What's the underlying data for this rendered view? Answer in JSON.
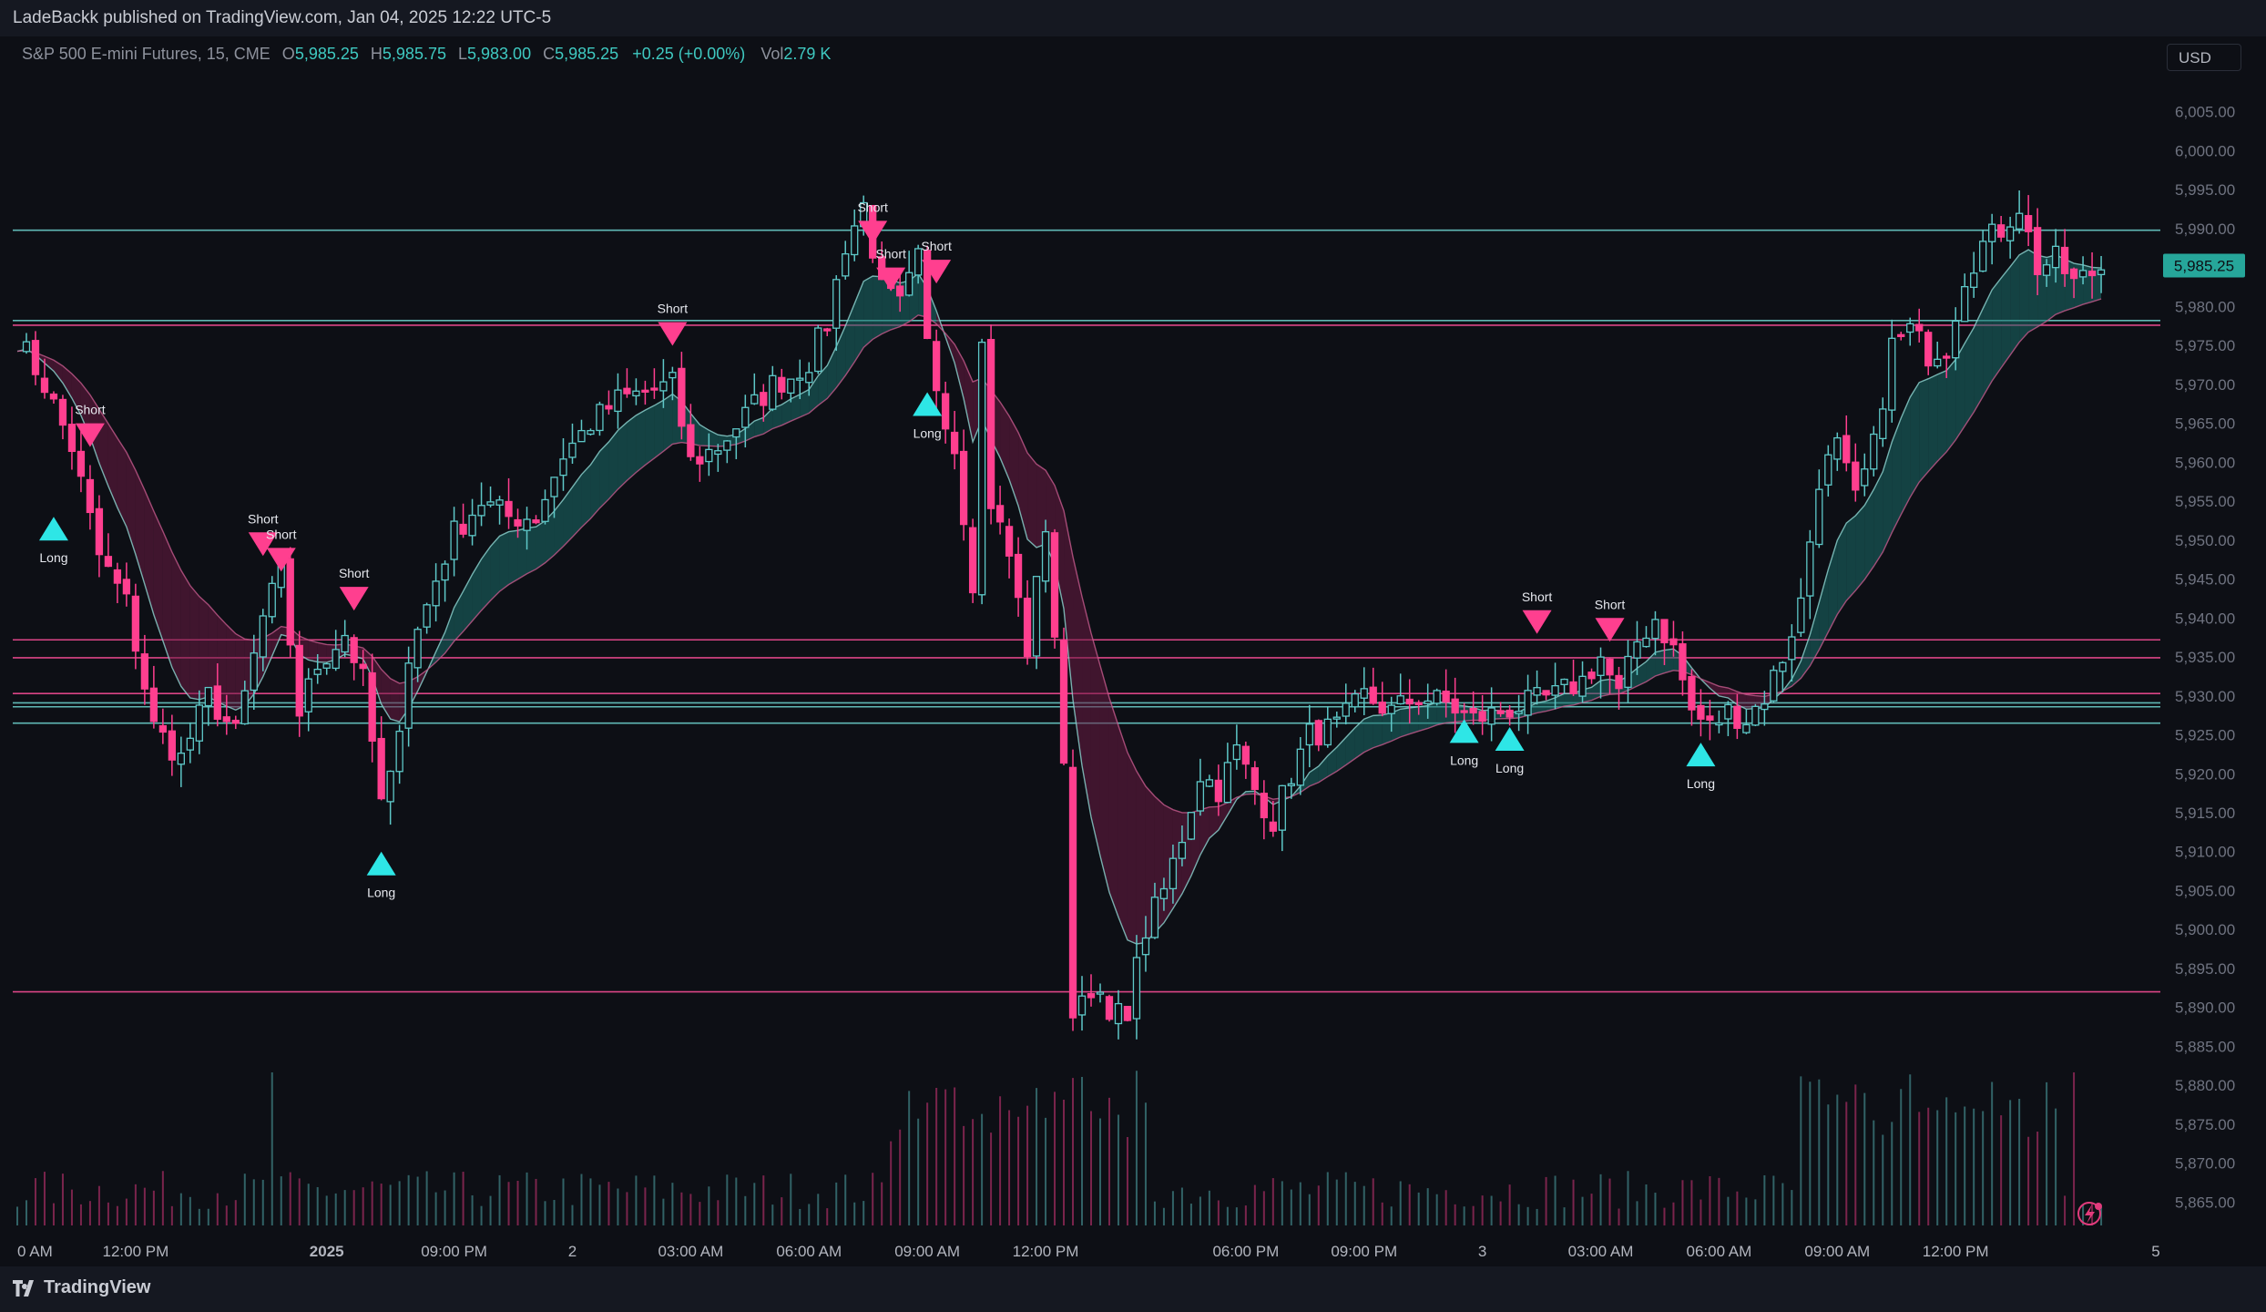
{
  "header": {
    "published": "LadeBackk published on TradingView.com, Jan 04, 2025 12:22 UTC-5"
  },
  "legend": {
    "symbol": "S&P 500 E-mini Futures, 15, CME",
    "o_label": "O",
    "o": "5,985.25",
    "h_label": "H",
    "h": "5,985.75",
    "l_label": "L",
    "l": "5,983.00",
    "c_label": "C",
    "c": "5,985.25",
    "change": "+0.25 (+0.00%)",
    "vol_label": "Vol",
    "vol": "2.79 K"
  },
  "currency": "USD",
  "footer": {
    "brand": "TradingView"
  },
  "colors": {
    "bull": "#5ec8c8",
    "bear": "#ff3f8f",
    "level_teal": "#6fd6d2",
    "level_pink": "#ff4f9a",
    "cloud_bull": "#1c6e6a",
    "cloud_bear": "#6b1c43",
    "label": "#e6e8ee"
  },
  "chart_data": {
    "type": "candlestick",
    "ylim": [
      5862,
      6010
    ],
    "yticks": [
      "6,005.00",
      "6,000.00",
      "5,995.00",
      "5,990.00",
      "5,985.00",
      "5,980.00",
      "5,975.00",
      "5,970.00",
      "5,965.00",
      "5,960.00",
      "5,955.00",
      "5,950.00",
      "5,945.00",
      "5,940.00",
      "5,935.00",
      "5,930.00",
      "5,925.00",
      "5,920.00",
      "5,915.00",
      "5,910.00",
      "5,905.00",
      "5,900.00",
      "5,895.00",
      "5,890.00",
      "5,885.00",
      "5,880.00",
      "5,875.00",
      "5,870.00",
      "5,865.00"
    ],
    "ytick_values": [
      6005,
      6000,
      5995,
      5990,
      5985,
      5980,
      5975,
      5970,
      5965,
      5960,
      5955,
      5950,
      5945,
      5940,
      5935,
      5930,
      5925,
      5920,
      5915,
      5910,
      5905,
      5900,
      5895,
      5890,
      5885,
      5880,
      5875,
      5870,
      5865
    ],
    "last_price": "5,985.25",
    "last_price_value": 5985.25,
    "xticks": [
      "0 AM",
      "12:00 PM",
      "2025",
      "09:00 PM",
      "2",
      "03:00 AM",
      "06:00 AM",
      "09:00 AM",
      "12:00 PM",
      "06:00 PM",
      "09:00 PM",
      "3",
      "03:00 AM",
      "06:00 AM",
      "09:00 AM",
      "12:00 PM",
      "5"
    ],
    "xtick_bars": [
      0,
      13,
      34,
      48,
      61,
      74,
      87,
      100,
      113,
      135,
      148,
      161,
      174,
      187,
      200,
      213,
      235
    ],
    "levels": [
      {
        "price": 5989.8,
        "color": "teal"
      },
      {
        "price": 5978.2,
        "color": "teal"
      },
      {
        "price": 5977.6,
        "color": "pink"
      },
      {
        "price": 5937.2,
        "color": "pink"
      },
      {
        "price": 5934.9,
        "color": "pink"
      },
      {
        "price": 5930.3,
        "color": "pink"
      },
      {
        "price": 5929.1,
        "color": "teal"
      },
      {
        "price": 5928.6,
        "color": "teal"
      },
      {
        "price": 5926.5,
        "color": "teal"
      },
      {
        "price": 5892.0,
        "color": "pink"
      }
    ],
    "price_path": [
      [
        0,
        5976
      ],
      [
        3,
        5970
      ],
      [
        6,
        5962
      ],
      [
        9,
        5948
      ],
      [
        12,
        5942
      ],
      [
        15,
        5926
      ],
      [
        18,
        5922
      ],
      [
        21,
        5930
      ],
      [
        24,
        5925
      ],
      [
        27,
        5940
      ],
      [
        29,
        5946
      ],
      [
        31,
        5928
      ],
      [
        33,
        5934
      ],
      [
        36,
        5938
      ],
      [
        38,
        5932
      ],
      [
        40,
        5916
      ],
      [
        41,
        5919
      ],
      [
        43,
        5935
      ],
      [
        46,
        5945
      ],
      [
        48,
        5951
      ],
      [
        51,
        5955
      ],
      [
        54,
        5953
      ],
      [
        57,
        5953
      ],
      [
        60,
        5961
      ],
      [
        63,
        5965
      ],
      [
        66,
        5968
      ],
      [
        69,
        5969
      ],
      [
        72,
        5970
      ],
      [
        74,
        5960
      ],
      [
        77,
        5962
      ],
      [
        80,
        5966
      ],
      [
        83,
        5970
      ],
      [
        85,
        5971
      ],
      [
        87,
        5973
      ],
      [
        89,
        5978
      ],
      [
        91,
        5988
      ],
      [
        93,
        5993
      ],
      [
        95,
        5982
      ],
      [
        97,
        5980
      ],
      [
        99,
        5986
      ],
      [
        100,
        5975
      ],
      [
        101,
        5970
      ],
      [
        103,
        5962
      ],
      [
        105,
        5945
      ],
      [
        106,
        5975
      ],
      [
        107,
        5955
      ],
      [
        109,
        5948
      ],
      [
        111,
        5936
      ],
      [
        113,
        5952
      ],
      [
        114,
        5938
      ],
      [
        115,
        5920
      ],
      [
        116,
        5890
      ],
      [
        118,
        5893
      ],
      [
        120,
        5888
      ],
      [
        122,
        5890
      ],
      [
        124,
        5900
      ],
      [
        126,
        5905
      ],
      [
        128,
        5912
      ],
      [
        130,
        5920
      ],
      [
        132,
        5918
      ],
      [
        134,
        5923
      ],
      [
        136,
        5918
      ],
      [
        138,
        5914
      ],
      [
        140,
        5920
      ],
      [
        142,
        5925
      ],
      [
        145,
        5926
      ],
      [
        148,
        5930
      ],
      [
        151,
        5928
      ],
      [
        154,
        5930
      ],
      [
        157,
        5929
      ],
      [
        160,
        5927
      ],
      [
        163,
        5928
      ],
      [
        166,
        5929
      ],
      [
        169,
        5930
      ],
      [
        172,
        5932
      ],
      [
        174,
        5935
      ],
      [
        176,
        5930
      ],
      [
        178,
        5937
      ],
      [
        180,
        5940
      ],
      [
        182,
        5936
      ],
      [
        184,
        5928
      ],
      [
        186,
        5926
      ],
      [
        188,
        5928
      ],
      [
        190,
        5927
      ],
      [
        192,
        5930
      ],
      [
        194,
        5935
      ],
      [
        196,
        5942
      ],
      [
        198,
        5958
      ],
      [
        200,
        5962
      ],
      [
        202,
        5955
      ],
      [
        204,
        5962
      ],
      [
        206,
        5975
      ],
      [
        208,
        5977
      ],
      [
        210,
        5974
      ],
      [
        212,
        5975
      ],
      [
        214,
        5984
      ],
      [
        216,
        5988
      ],
      [
        218,
        5990
      ],
      [
        220,
        5993
      ],
      [
        222,
        5985
      ],
      [
        224,
        5986
      ],
      [
        226,
        5983
      ],
      [
        229,
        5985
      ]
    ],
    "signals": [
      {
        "type": "Short",
        "bar": 8,
        "price": 5965
      },
      {
        "type": "Long",
        "bar": 4,
        "price": 5953
      },
      {
        "type": "Short",
        "bar": 27,
        "price": 5951
      },
      {
        "type": "Short",
        "bar": 29,
        "price": 5949
      },
      {
        "type": "Short",
        "bar": 37,
        "price": 5944
      },
      {
        "type": "Long",
        "bar": 40,
        "price": 5910
      },
      {
        "type": "Short",
        "bar": 72,
        "price": 5978
      },
      {
        "type": "Short",
        "bar": 94,
        "price": 5991
      },
      {
        "type": "Short",
        "bar": 96,
        "price": 5985
      },
      {
        "type": "Short",
        "bar": 101,
        "price": 5986
      },
      {
        "type": "Long",
        "bar": 100,
        "price": 5969
      },
      {
        "type": "Short",
        "bar": 167,
        "price": 5941
      },
      {
        "type": "Short",
        "bar": 175,
        "price": 5940
      },
      {
        "type": "Long",
        "bar": 159,
        "price": 5927
      },
      {
        "type": "Long",
        "bar": 164,
        "price": 5926
      },
      {
        "type": "Long",
        "bar": 185,
        "price": 5924
      }
    ]
  }
}
